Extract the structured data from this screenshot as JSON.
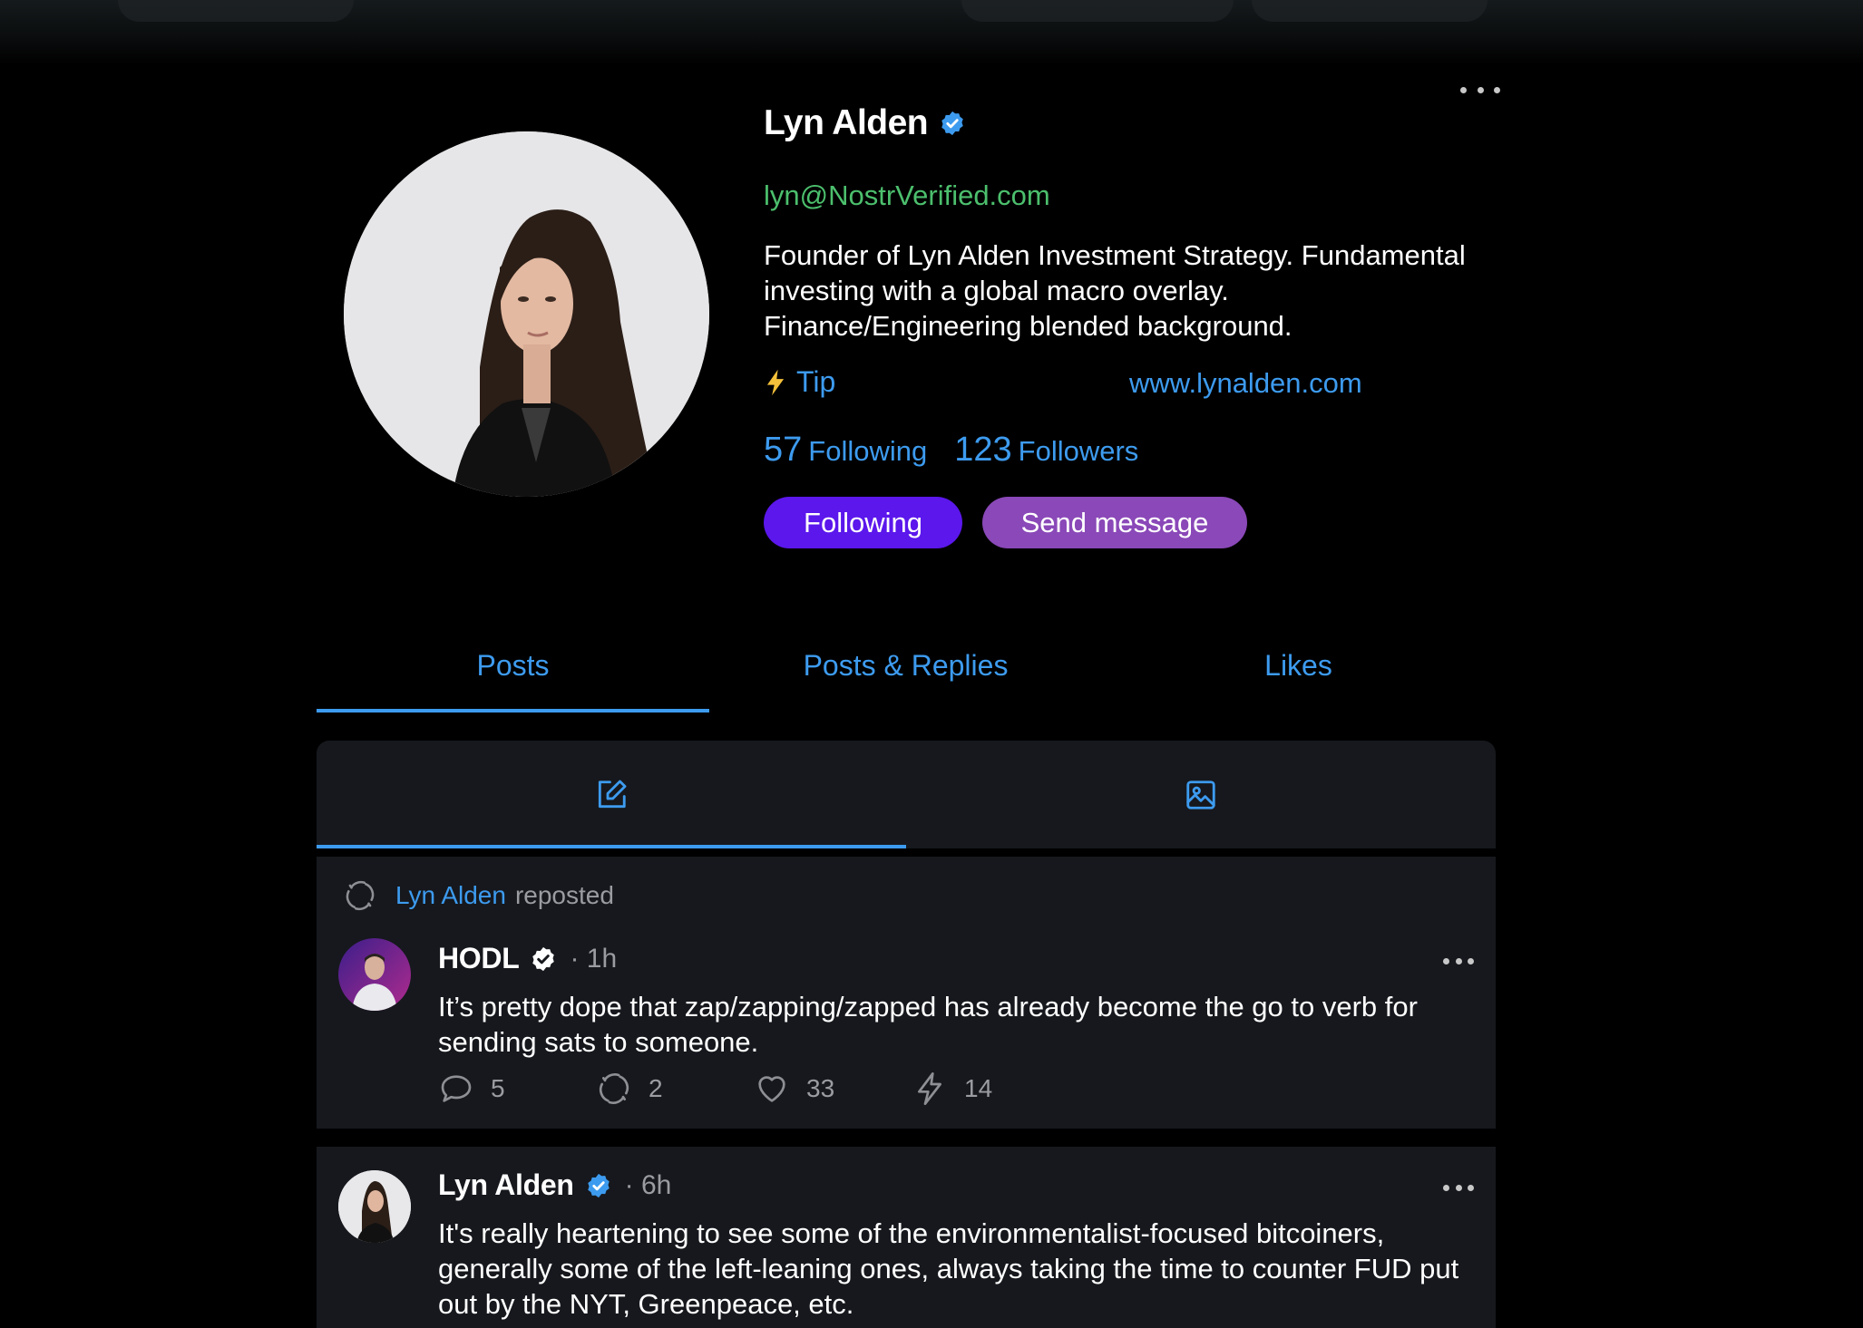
{
  "profile": {
    "name": "Lyn Alden",
    "nip05": "lyn@NostrVerified.com",
    "bio": "Founder of Lyn Alden Investment Strategy. Fundamental investing with a global macro overlay. Finance/Engineering blended background.",
    "tip_label": "Tip",
    "website": "www.lynalden.com",
    "following_count": "57",
    "following_label": "Following",
    "followers_count": "123",
    "followers_label": "Followers",
    "follow_button": "Following",
    "message_button": "Send message"
  },
  "tabs": [
    "Posts",
    "Posts & Replies",
    "Likes"
  ],
  "active_tab": "Posts",
  "feed_tabs": [
    {
      "icon": "edit-note-icon",
      "active": true
    },
    {
      "icon": "image-icon",
      "active": false
    }
  ],
  "posts": [
    {
      "repost_by": "Lyn Alden",
      "repost_label": "reposted",
      "author": "HODL",
      "verified": true,
      "time": "1h",
      "text": "It’s pretty dope that zap/zapping/zapped has already become the go to verb for sending sats to someone.",
      "replies": "5",
      "reposts": "2",
      "likes": "33",
      "zaps": "14"
    },
    {
      "author": "Lyn Alden",
      "verified": true,
      "time": "6h",
      "text": "It's really heartening to see some of the environmentalist-focused bitcoiners, generally some of the left-leaning ones, always taking the time to counter FUD put out by the NYT, Greenpeace, etc."
    }
  ],
  "colors": {
    "accent_blue": "#3d9bef",
    "nip05_green": "#4cbf6d",
    "follow_button": "#5b17ec",
    "message_button": "#8a48b8",
    "card_bg": "#16181d"
  }
}
